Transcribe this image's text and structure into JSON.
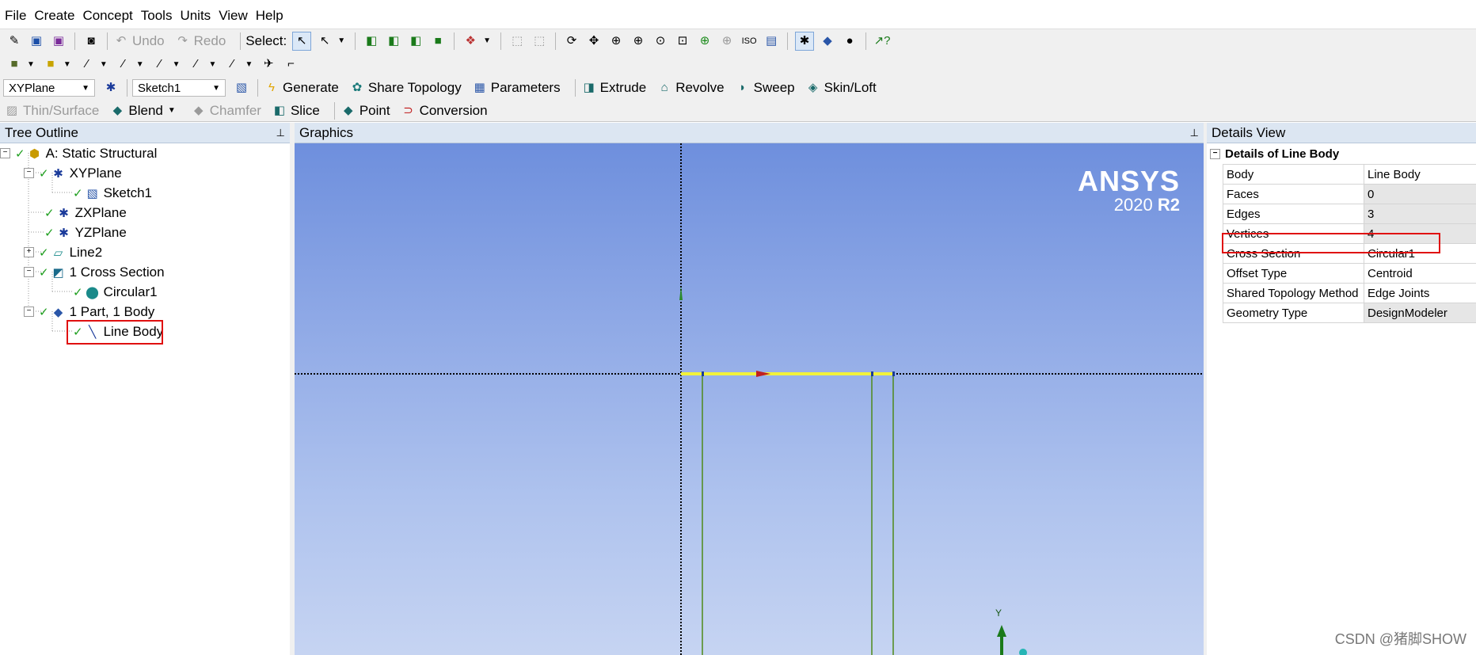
{
  "menu": [
    "File",
    "Create",
    "Concept",
    "Tools",
    "Units",
    "View",
    "Help"
  ],
  "toolbar1": {
    "undo_label": "Undo",
    "redo_label": "Redo",
    "select_label": "Select:"
  },
  "toolbar3": {
    "plane_value": "XYPlane",
    "sketch_value": "Sketch1",
    "buttons": [
      "Generate",
      "Share Topology",
      "Parameters",
      "Extrude",
      "Revolve",
      "Sweep",
      "Skin/Loft"
    ]
  },
  "toolbar4": {
    "buttons": [
      "Thin/Surface",
      "Blend",
      "Chamfer",
      "Slice",
      "Point",
      "Conversion"
    ]
  },
  "tree": {
    "header": "Tree Outline",
    "items": [
      {
        "label": "A: Static Structural",
        "icon": "model-icon"
      },
      {
        "label": "XYPlane",
        "icon": "plane-icon"
      },
      {
        "label": "Sketch1",
        "icon": "sketch-icon"
      },
      {
        "label": "ZXPlane",
        "icon": "plane-icon"
      },
      {
        "label": "YZPlane",
        "icon": "plane-icon"
      },
      {
        "label": "Line2",
        "icon": "line-feature-icon"
      },
      {
        "label": "1 Cross Section",
        "icon": "cross-section-icon"
      },
      {
        "label": "Circular1",
        "icon": "circle-section-icon"
      },
      {
        "label": "1 Part, 1 Body",
        "icon": "part-icon"
      },
      {
        "label": "Line Body",
        "icon": "line-body-icon"
      }
    ]
  },
  "graphics": {
    "header": "Graphics",
    "brand_name": "ANSYS",
    "brand_version_year": "2020",
    "brand_version_release": "R2",
    "triad_label": "Y"
  },
  "details": {
    "header": "Details View",
    "title": "Details of Line Body",
    "rows": [
      {
        "key": "Body",
        "value": "Line Body"
      },
      {
        "key": "Faces",
        "value": "0"
      },
      {
        "key": "Edges",
        "value": "3"
      },
      {
        "key": "Vertices",
        "value": "4"
      },
      {
        "key": "Cross Section",
        "value": "Circular1"
      },
      {
        "key": "Offset Type",
        "value": "Centroid"
      },
      {
        "key": "Shared Topology Method",
        "value": "Edge Joints"
      },
      {
        "key": "Geometry Type",
        "value": "DesignModeler"
      }
    ]
  },
  "watermark": "CSDN @猪脚SHOW",
  "colors": {
    "highlight": "#e01010",
    "line_body": "#f2f23a",
    "check": "#1f9f1f"
  }
}
